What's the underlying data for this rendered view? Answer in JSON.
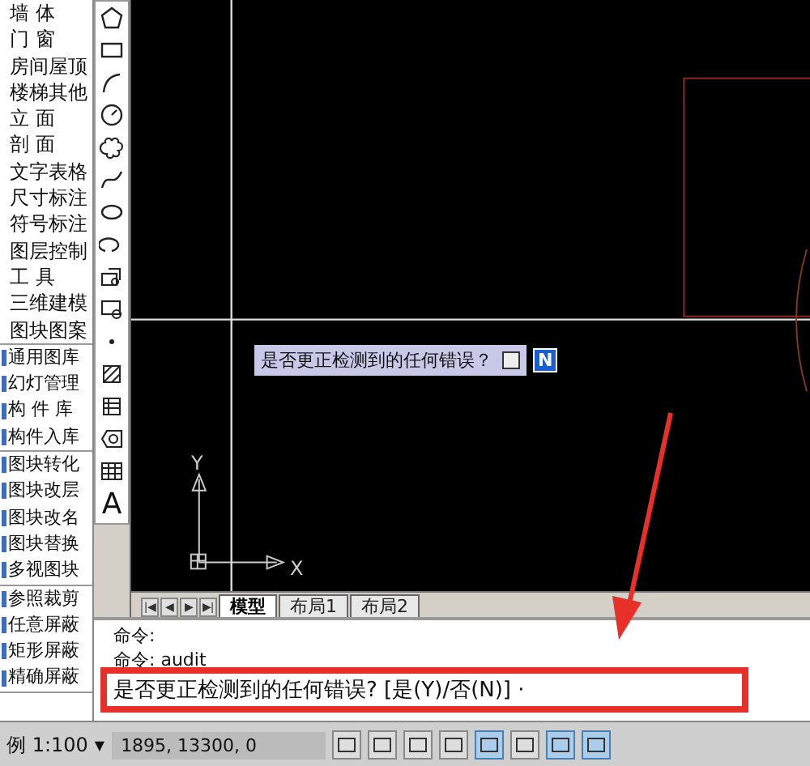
{
  "side_menu": {
    "groups": [
      {
        "items": [
          "墙 体",
          "门 窗",
          "房间屋顶",
          "楼梯其他",
          "立 面",
          "剖 面",
          "文字表格",
          "尺寸标注",
          "符号标注",
          "图层控制",
          "工 具",
          "三维建模",
          "图块图案"
        ]
      },
      {
        "items": [
          "通用图库",
          "幻灯管理",
          "构 件 库",
          "构件入库"
        ]
      },
      {
        "items": [
          "图块转化",
          "图块改层",
          "图块改名",
          "图块替换",
          "多视图块"
        ]
      },
      {
        "items": [
          "参照裁剪",
          "任意屏蔽",
          "矩形屏蔽",
          "精确屏蔽"
        ]
      }
    ]
  },
  "draw_toolbar": {
    "tools": [
      {
        "kind": "polygon"
      },
      {
        "kind": "rectangle"
      },
      {
        "kind": "arc"
      },
      {
        "kind": "circle"
      },
      {
        "kind": "cloud"
      },
      {
        "kind": "spline"
      },
      {
        "kind": "ellipse"
      },
      {
        "kind": "ellipse-arc"
      },
      {
        "kind": "insert"
      },
      {
        "kind": "block"
      },
      {
        "kind": "point"
      },
      {
        "kind": "hatch"
      },
      {
        "kind": "gradient"
      },
      {
        "kind": "region"
      },
      {
        "kind": "table"
      },
      {
        "kind": "text",
        "label": "A"
      }
    ]
  },
  "canvas": {
    "prompt": {
      "text": "是否更正检测到的任何错误？",
      "value": "N"
    },
    "ucs": {
      "x_label": "X",
      "y_label": "Y"
    }
  },
  "layout_tabs": {
    "nav": [
      "|◀",
      "◀",
      "▶",
      "▶|"
    ],
    "tabs": [
      {
        "label": "模型",
        "selected": true
      },
      {
        "label": "布局1",
        "selected": false
      },
      {
        "label": "布局2",
        "selected": false
      }
    ]
  },
  "command_window": {
    "lines": [
      "命令:",
      "命令:  audit",
      "是否更正检测到的任何错误? [是(Y)/否(N)] ·"
    ]
  },
  "status_bar": {
    "scale": "例 1:100",
    "scale_caret": "▼",
    "coordinates": "1895,  13300,  0",
    "toggles": [
      {
        "on": false
      },
      {
        "on": false
      },
      {
        "on": false
      },
      {
        "on": false
      },
      {
        "on": true
      },
      {
        "on": false
      },
      {
        "on": true
      },
      {
        "on": true
      }
    ]
  }
}
